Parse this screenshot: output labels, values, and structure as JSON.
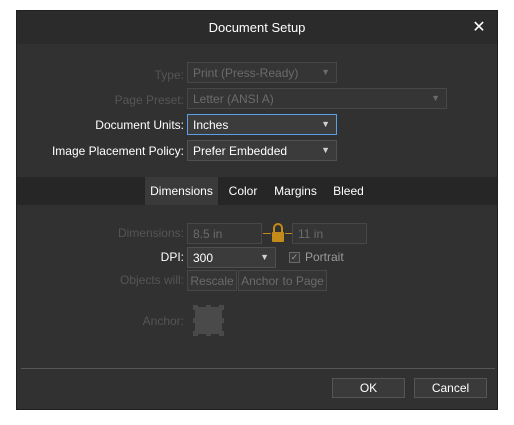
{
  "dialog": {
    "title": "Document Setup",
    "close_icon": "close-icon"
  },
  "settings": {
    "type_label": "Type:",
    "type_value": "Print (Press-Ready)",
    "preset_label": "Page Preset:",
    "preset_value": "Letter (ANSI A)",
    "units_label": "Document Units:",
    "units_value": "Inches",
    "placement_label": "Image Placement Policy:",
    "placement_value": "Prefer Embedded"
  },
  "tabs": [
    {
      "label": "Dimensions",
      "active": true
    },
    {
      "label": "Color",
      "active": false
    },
    {
      "label": "Margins",
      "active": false
    },
    {
      "label": "Bleed",
      "active": false
    }
  ],
  "dimensions": {
    "dimensions_label": "Dimensions:",
    "width_value": "8.5 in",
    "height_value": "11 in",
    "lock_icon": "lock-icon",
    "dpi_label": "DPI:",
    "dpi_value": "300",
    "portrait_label": "Portrait",
    "portrait_checked": true,
    "objects_label": "Objects will:",
    "rescale_label": "Rescale",
    "anchor_to_page_label": "Anchor to Page",
    "anchor_label": "Anchor:"
  },
  "footer": {
    "ok_label": "OK",
    "cancel_label": "Cancel"
  },
  "colors": {
    "dialog_bg": "#313131",
    "accent": "#5aa0e6",
    "lock": "#c48a1a"
  }
}
